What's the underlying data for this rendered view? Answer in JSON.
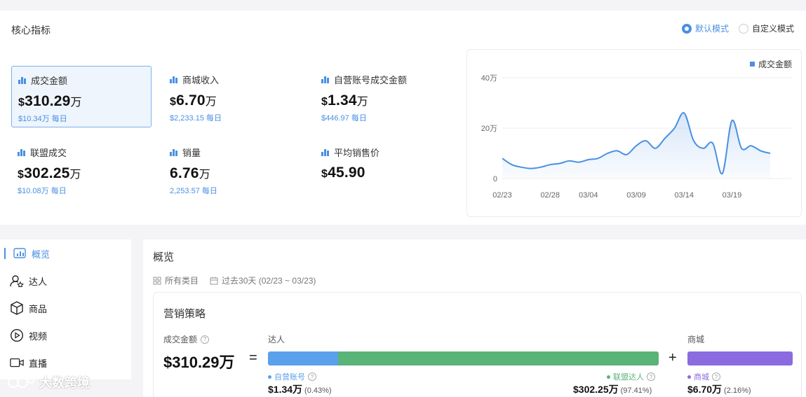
{
  "header": {
    "title": "核心指标"
  },
  "mode": {
    "default_label": "默认模式",
    "custom_label": "自定义模式",
    "selected": "default"
  },
  "metrics": [
    {
      "label": "成交金额",
      "currency": "$",
      "value": "310.29",
      "unit": "万",
      "daily": "$10.34万 每日",
      "active": true
    },
    {
      "label": "商城收入",
      "currency": "$",
      "value": "6.70",
      "unit": "万",
      "daily": "$2,233.15 每日",
      "active": false
    },
    {
      "label": "自营账号成交金额",
      "currency": "$",
      "value": "1.34",
      "unit": "万",
      "daily": "$446.97 每日",
      "active": false
    },
    {
      "label": "联盟成交",
      "currency": "$",
      "value": "302.25",
      "unit": "万",
      "daily": "$10.08万 每日",
      "active": false
    },
    {
      "label": "销量",
      "currency": "",
      "value": "6.76",
      "unit": "万",
      "daily": "2,253.57 每日",
      "active": false
    },
    {
      "label": "平均销售价",
      "currency": "$",
      "value": "45.90",
      "unit": "",
      "daily": "",
      "active": false
    }
  ],
  "chart_data": {
    "type": "area",
    "legend": "成交金额",
    "legend_position": "top-right",
    "y_ticks": [
      "0",
      "20万",
      "40万"
    ],
    "ylim": [
      0,
      400000
    ],
    "x_ticks": [
      "02/23",
      "02/28",
      "03/04",
      "03/09",
      "03/14",
      "03/19"
    ],
    "grid": true,
    "color": "#4a90e2",
    "series": [
      {
        "name": "成交金额",
        "x": [
          "02/23",
          "02/24",
          "02/25",
          "02/26",
          "02/27",
          "02/28",
          "03/01",
          "03/02",
          "03/03",
          "03/04",
          "03/05",
          "03/06",
          "03/07",
          "03/08",
          "03/09",
          "03/10",
          "03/11",
          "03/12",
          "03/13",
          "03/14",
          "03/15",
          "03/16",
          "03/17",
          "03/18",
          "03/19",
          "03/20",
          "03/21",
          "03/22",
          "03/23"
        ],
        "values": [
          80000,
          55000,
          45000,
          40000,
          45000,
          55000,
          60000,
          70000,
          65000,
          75000,
          80000,
          100000,
          110000,
          95000,
          130000,
          150000,
          120000,
          160000,
          200000,
          260000,
          150000,
          120000,
          140000,
          20000,
          230000,
          120000,
          130000,
          110000,
          100000
        ]
      }
    ]
  },
  "nav": {
    "items": [
      {
        "label": "概览",
        "icon": "overview-icon",
        "active": true
      },
      {
        "label": "达人",
        "icon": "influencer-icon",
        "active": false
      },
      {
        "label": "商品",
        "icon": "product-icon",
        "active": false
      },
      {
        "label": "视频",
        "icon": "video-icon",
        "active": false
      },
      {
        "label": "直播",
        "icon": "live-icon",
        "active": false
      }
    ]
  },
  "overview": {
    "title": "概览",
    "filter_category": "所有类目",
    "filter_date": "过去30天 (02/23 ~ 03/23)",
    "strategy": {
      "title": "营销策略",
      "gmv_label": "成交金额",
      "gmv_value": "$310.29万",
      "eq": "=",
      "plus": "+",
      "influencer_label": "达人",
      "mall_label": "商城",
      "self_label": "自营账号",
      "self_value": "$1.34万",
      "self_pct": "(0.43%)",
      "affiliate_label": "联盟达人",
      "affiliate_value": "$302.25万",
      "affiliate_pct": "(97.41%)",
      "mall_sub_label": "商城",
      "mall_value": "$6.70万",
      "mall_pct": "(2.16%)",
      "self_share": 0.0043,
      "affiliate_share": 0.9741,
      "colors": {
        "self": "#5aa0ea",
        "affiliate": "#5ab377",
        "mall": "#8a6be0"
      }
    }
  },
  "watermark": {
    "text": "大数跨境"
  }
}
